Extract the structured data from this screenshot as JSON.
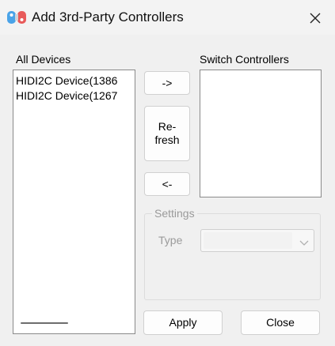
{
  "window": {
    "title": "Add 3rd-Party Controllers"
  },
  "icons": {
    "app": "gamepad-icon",
    "close": "close-icon",
    "dropdown": "chevron-down-icon"
  },
  "all_devices": {
    "label": "All Devices",
    "items": [
      "HIDI2C Device(1386",
      "HIDI2C Device(1267"
    ]
  },
  "switch_controllers": {
    "label": "Switch Controllers",
    "items": []
  },
  "buttons": {
    "add": "->",
    "refresh": "Re-\nfresh",
    "remove": "<-",
    "apply": "Apply",
    "close": "Close"
  },
  "settings": {
    "title": "Settings",
    "type_label": "Type",
    "type_value": ""
  },
  "colors": {
    "background": "#f0f0f0",
    "disabled_text": "#9a9a9a",
    "list_border": "#8a8a8a"
  }
}
